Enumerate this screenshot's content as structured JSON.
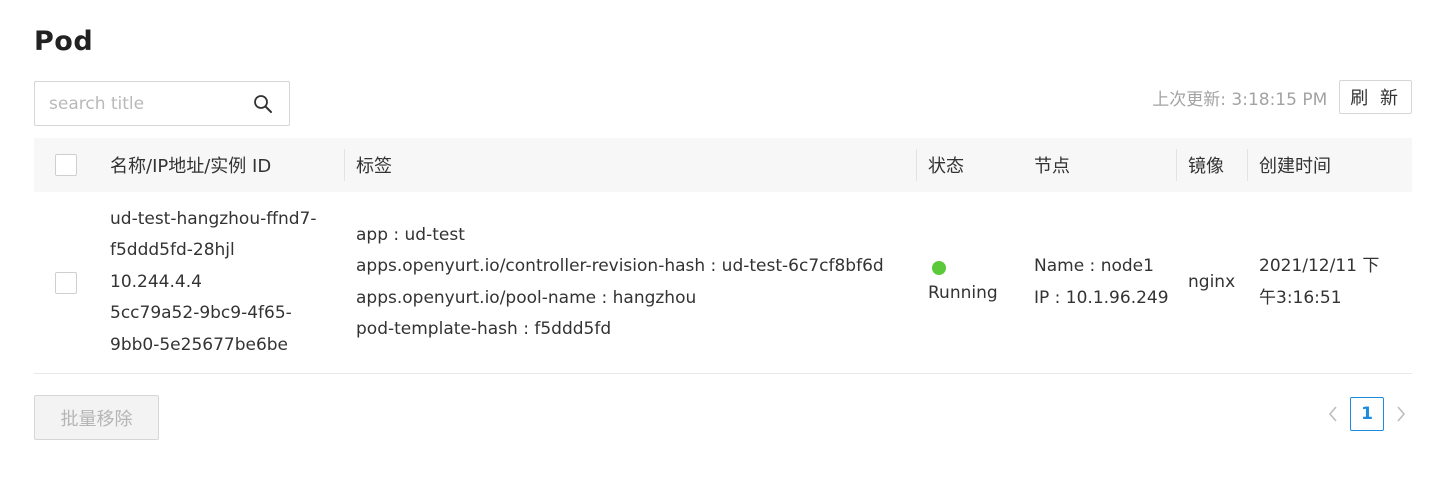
{
  "page": {
    "title": "Pod"
  },
  "search": {
    "placeholder": "search title",
    "value": ""
  },
  "toolbar": {
    "last_updated": "上次更新: 3:18:15 PM",
    "refresh_label": "刷 新"
  },
  "table": {
    "columns": [
      "名称/IP地址/实例 ID",
      "标签",
      "状态",
      "节点",
      "镜像",
      "创建时间"
    ],
    "rows": [
      {
        "name_lines": [
          "ud-test-hangzhou-ffnd7-",
          "f5ddd5fd-28hjl",
          "10.244.4.4",
          "5cc79a52-9bc9-4f65-",
          "9bb0-5e25677be6be"
        ],
        "tags": [
          "app : ud-test",
          "apps.openyurt.io/controller-revision-hash : ud-test-6c7cf8bf6d",
          "apps.openyurt.io/pool-name : hangzhou",
          "pod-template-hash : f5ddd5fd"
        ],
        "status": "Running",
        "status_color": "#5cc93b",
        "node_lines": [
          "Name : node1",
          "IP : 10.1.96.249"
        ],
        "image": "nginx",
        "created_lines": [
          "2021/12/11 下",
          "午3:16:51"
        ]
      }
    ]
  },
  "footer": {
    "batch_remove_label": "批量移除"
  },
  "pagination": {
    "current_page": "1",
    "prev_icon": "chevron-left-icon",
    "next_icon": "chevron-right-icon"
  },
  "colors": {
    "accent": "#1b8ce0",
    "header_bg": "#f7f7f7"
  },
  "icons": {
    "search": "search-icon"
  }
}
